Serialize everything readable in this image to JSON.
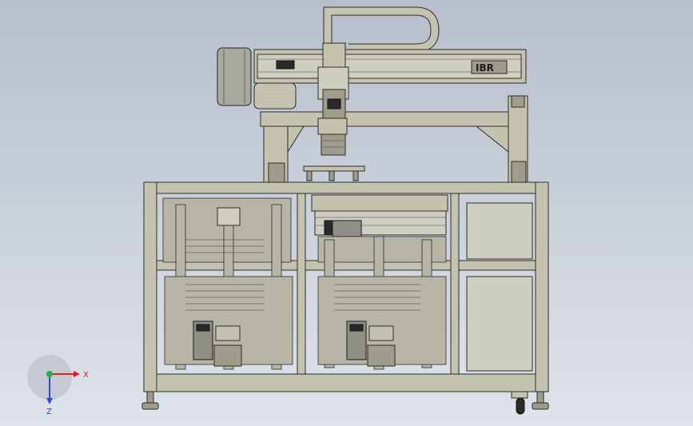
{
  "viewer": {
    "background_top": "#b7bfcc",
    "background_bottom": "#dfe3ea"
  },
  "model": {
    "gantry_logo": "IBR"
  },
  "axis_triad": {
    "x_label": "X",
    "z_label": "Z",
    "x_color": "#e21d1d",
    "y_color": "#22b14c",
    "z_color": "#2a4bd7"
  }
}
